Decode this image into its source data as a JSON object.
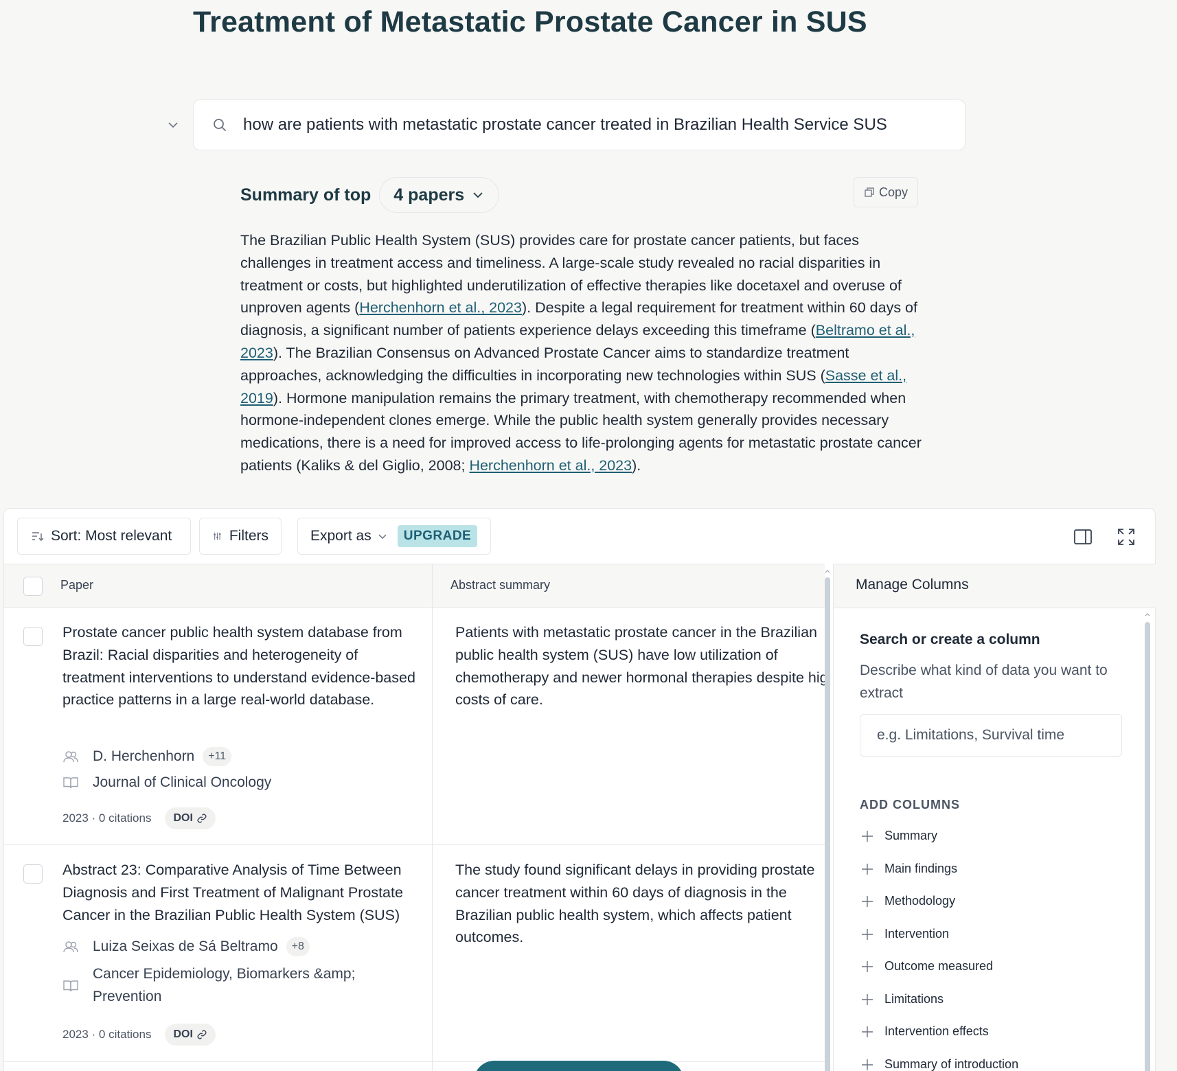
{
  "page": {
    "title": "Treatment of Metastatic Prostate Cancer in SUS"
  },
  "search": {
    "query": "how are patients with metastatic prostate cancer treated in Brazilian Health Service SUS"
  },
  "summary": {
    "label": "Summary of top",
    "papers_selector": "4 papers",
    "copy_label": "Copy",
    "segments": [
      {
        "text": "The Brazilian Public Health System (SUS) provides care for prostate cancer patients, but faces challenges in treatment access and timeliness. A large-scale study revealed no racial disparities in treatment or costs, but highlighted underutilization of effective therapies like docetaxel and overuse of unproven agents ("
      },
      {
        "text": "Herchenhorn et al., 2023",
        "link": true
      },
      {
        "text": "). Despite a legal requirement for treatment within 60 days of diagnosis, a significant number of patients experience delays exceeding this timeframe ("
      },
      {
        "text": "Beltramo et al., 2023",
        "link": true
      },
      {
        "text": "). The Brazilian Consensus on Advanced Prostate Cancer aims to standardize treatment approaches, acknowledging the difficulties in incorporating new technologies within SUS ("
      },
      {
        "text": "Sasse et al., 2019",
        "link": true
      },
      {
        "text": "). Hormone manipulation remains the primary treatment, with chemotherapy recommended when hormone-independent clones emerge. While the public health system generally provides necessary medications, there is a need for improved access to life-prolonging agents for metastatic prostate cancer patients (Kaliks & del Giglio, 2008; "
      },
      {
        "text": "Herchenhorn et al., 2023",
        "link": true
      },
      {
        "text": ")."
      }
    ]
  },
  "toolbar": {
    "sort_label": "Sort: Most relevant",
    "filters_label": "Filters",
    "export_label": "Export as",
    "upgrade_badge": "UPGRADE"
  },
  "table": {
    "columns": [
      "Paper",
      "Abstract summary"
    ],
    "rows": [
      {
        "title": "Prostate cancer public health system database from Brazil: Racial disparities and heterogeneity of treatment interventions to understand evidence-based practice patterns in a large real-world database.",
        "author": "D. Herchenhorn",
        "more_authors": "+11",
        "journal": "Journal of Clinical Oncology",
        "stats": "2023 · 0 citations",
        "doi_label": "DOI",
        "abstract_lines": [
          "Patients with metastatic prostate cancer in the Brazilian",
          "public health system (SUS) have low utilization of",
          "chemotherapy and newer hormonal therapies despite high",
          "costs of care."
        ]
      },
      {
        "title": "Abstract 23: Comparative Analysis of Time Between Diagnosis and First Treatment of Malignant Prostate Cancer in the Brazilian Public Health System (SUS)",
        "author": "Luiza Seixas de Sá Beltramo",
        "more_authors": "+8",
        "journal": "Cancer Epidemiology, Biomarkers &amp; Prevention",
        "stats": "2023 · 0 citations",
        "doi_label": "DOI",
        "abstract_lines": [
          "The study found significant delays in providing prostate",
          "cancer treatment within 60 days of diagnosis in the",
          "Brazilian public health system, which affects patient",
          "outcomes."
        ]
      }
    ]
  },
  "manage_columns": {
    "header": "Manage Columns",
    "search_title": "Search or create a column",
    "search_description": "Describe what kind of data you want to extract",
    "input_placeholder": "e.g. Limitations, Survival time",
    "add_columns_label": "ADD COLUMNS",
    "options": [
      "Summary",
      "Main findings",
      "Methodology",
      "Intervention",
      "Outcome measured",
      "Limitations",
      "Intervention effects",
      "Summary of introduction"
    ]
  },
  "colors": {
    "title": "#1e3a44",
    "link": "#1e5f74",
    "upgrade_bg": "#b9e3e6",
    "primary_button": "#1e6a7a"
  }
}
